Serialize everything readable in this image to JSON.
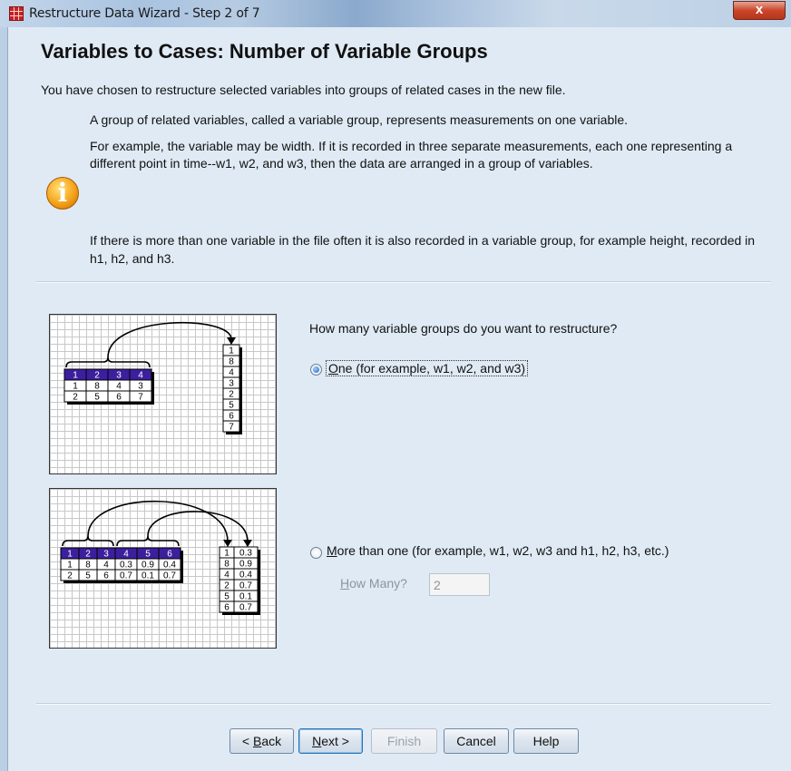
{
  "window": {
    "title": "Restructure Data Wizard - Step 2 of 7",
    "close_label": "x"
  },
  "header": {
    "title": "Variables to Cases: Number of Variable Groups",
    "intro": "You have chosen to restructure selected variables into groups of related cases in the new file."
  },
  "info": {
    "p1": "A group of related variables, called a variable group, represents measurements on one variable.",
    "p2": "For example, the variable may be width.  If it is recorded in three separate measurements, each one representing a different point in time--w1, w2, and w3, then the data are arranged in a group of variables.",
    "p3": "If there is more than one variable in the file often it is also recorded in a variable group, for example height, recorded in h1, h2, and h3."
  },
  "question": "How many variable groups do you want to restructure?",
  "options": {
    "one": {
      "label_mnemonic": "O",
      "label_rest": "ne (for example, w1, w2, and w3)",
      "selected": true
    },
    "more": {
      "label_mnemonic": "M",
      "label_rest": "ore than one (for example, w1, w2, w3 and h1, h2, h3, etc.)",
      "selected": false
    }
  },
  "how_many": {
    "label_mnemonic": "H",
    "label_rest": "ow Many?",
    "value": "2",
    "enabled": false
  },
  "diagram1": {
    "header": [
      "1",
      "2",
      "3",
      "4"
    ],
    "rows": [
      [
        "1",
        "8",
        "4",
        "3"
      ],
      [
        "2",
        "5",
        "6",
        "7"
      ]
    ],
    "column": [
      "1",
      "8",
      "4",
      "3",
      "2",
      "5",
      "6",
      "7"
    ]
  },
  "diagram2": {
    "header": [
      "1",
      "2",
      "3",
      "4",
      "5",
      "6"
    ],
    "rows": [
      [
        "1",
        "8",
        "4",
        "0.3",
        "0.9",
        "0.4"
      ],
      [
        "2",
        "5",
        "6",
        "0.7",
        "0.1",
        "0.7"
      ]
    ],
    "col_a": [
      "1",
      "8",
      "4",
      "2",
      "5",
      "6"
    ],
    "col_b": [
      "0.3",
      "0.9",
      "0.4",
      "0.7",
      "0.1",
      "0.7"
    ]
  },
  "buttons": {
    "back_prefix": "< ",
    "back_mnemonic": "B",
    "back_rest": "ack",
    "next_mnemonic": "N",
    "next_rest": "ext >",
    "finish": "Finish",
    "cancel": "Cancel",
    "help": "Help"
  },
  "colors": {
    "header_cell": "#3c1f9e",
    "client_bg": "#dfeaf4"
  }
}
